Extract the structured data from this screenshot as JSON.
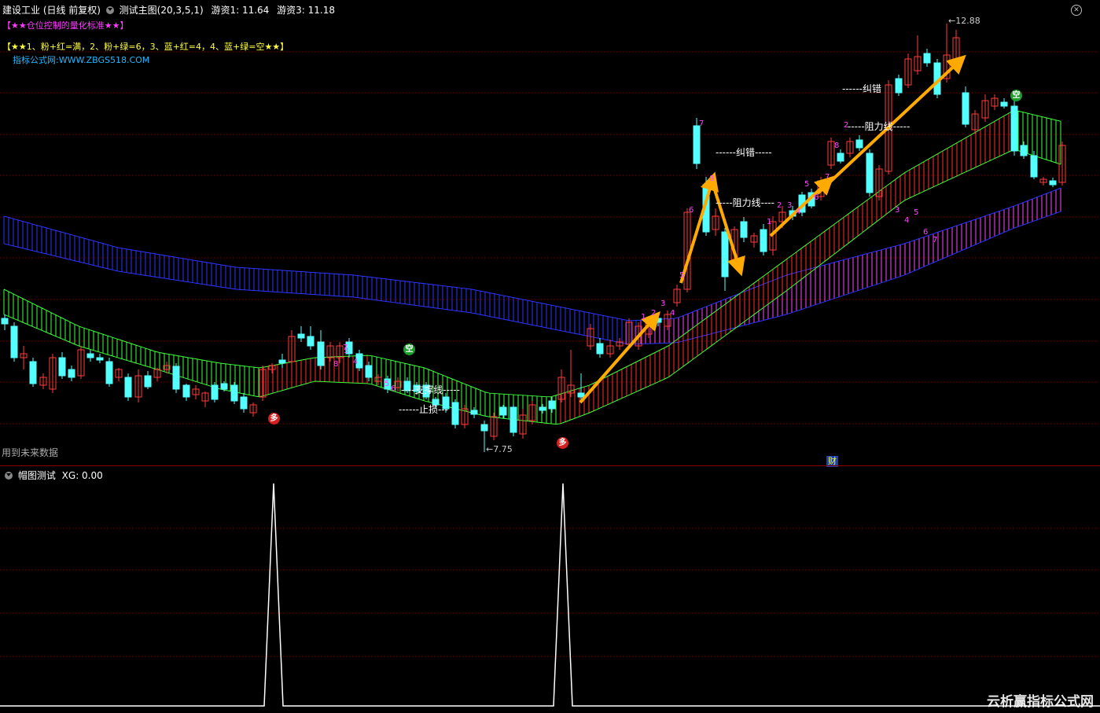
{
  "header": {
    "stock_title": "建设工业 (日线 前复权)",
    "indicator_title": "测试主图(20,3,5,1)",
    "youzi1_label": "游资1: 11.64",
    "youzi3_label": "游资3: 11.18"
  },
  "legend": {
    "title": "【★★仓位控制的量化标准★★】",
    "rule": "【★★1、粉+红=满，2、粉+绿=6，3、蓝+红=4，4、蓝+绿=空★★】",
    "site": "指标公式网:WWW.ZBGS518.COM"
  },
  "annotations": {
    "high_price": "12.88",
    "low_price": "7.75",
    "correction1": "------纠错-----",
    "correction2": "------纠错",
    "resistance1": "-----阻力线----",
    "resistance2": "-----阻力线-----",
    "support": "----支撑线-----",
    "stoploss": "------止损---",
    "future_data": "用到未来数据",
    "duo1": "多",
    "duo2": "多",
    "kong1": "空",
    "kong2": "空",
    "cai": "财"
  },
  "wave_numbers": [
    "7",
    "8",
    "6",
    "5",
    "4",
    "3",
    "2",
    "1",
    "3",
    "4",
    "5",
    "6",
    "7",
    "8",
    "1",
    "2",
    "3",
    "4",
    "5",
    "6",
    "7",
    "8",
    "2",
    "3",
    "4",
    "5",
    "6",
    "7"
  ],
  "sub_panel": {
    "title": "帽图测试",
    "xg_label": "XG: 0.00"
  },
  "watermark": "云析赢指标公式网",
  "colors": {
    "bull": "#ff3c3c",
    "bear": "#54ffff",
    "blue_band": "#2c35ff",
    "green_band": "#3dff3d",
    "red_band": "#ff2b2b",
    "magenta_band": "#ff44ff",
    "arrow": "#ffaa00"
  }
}
